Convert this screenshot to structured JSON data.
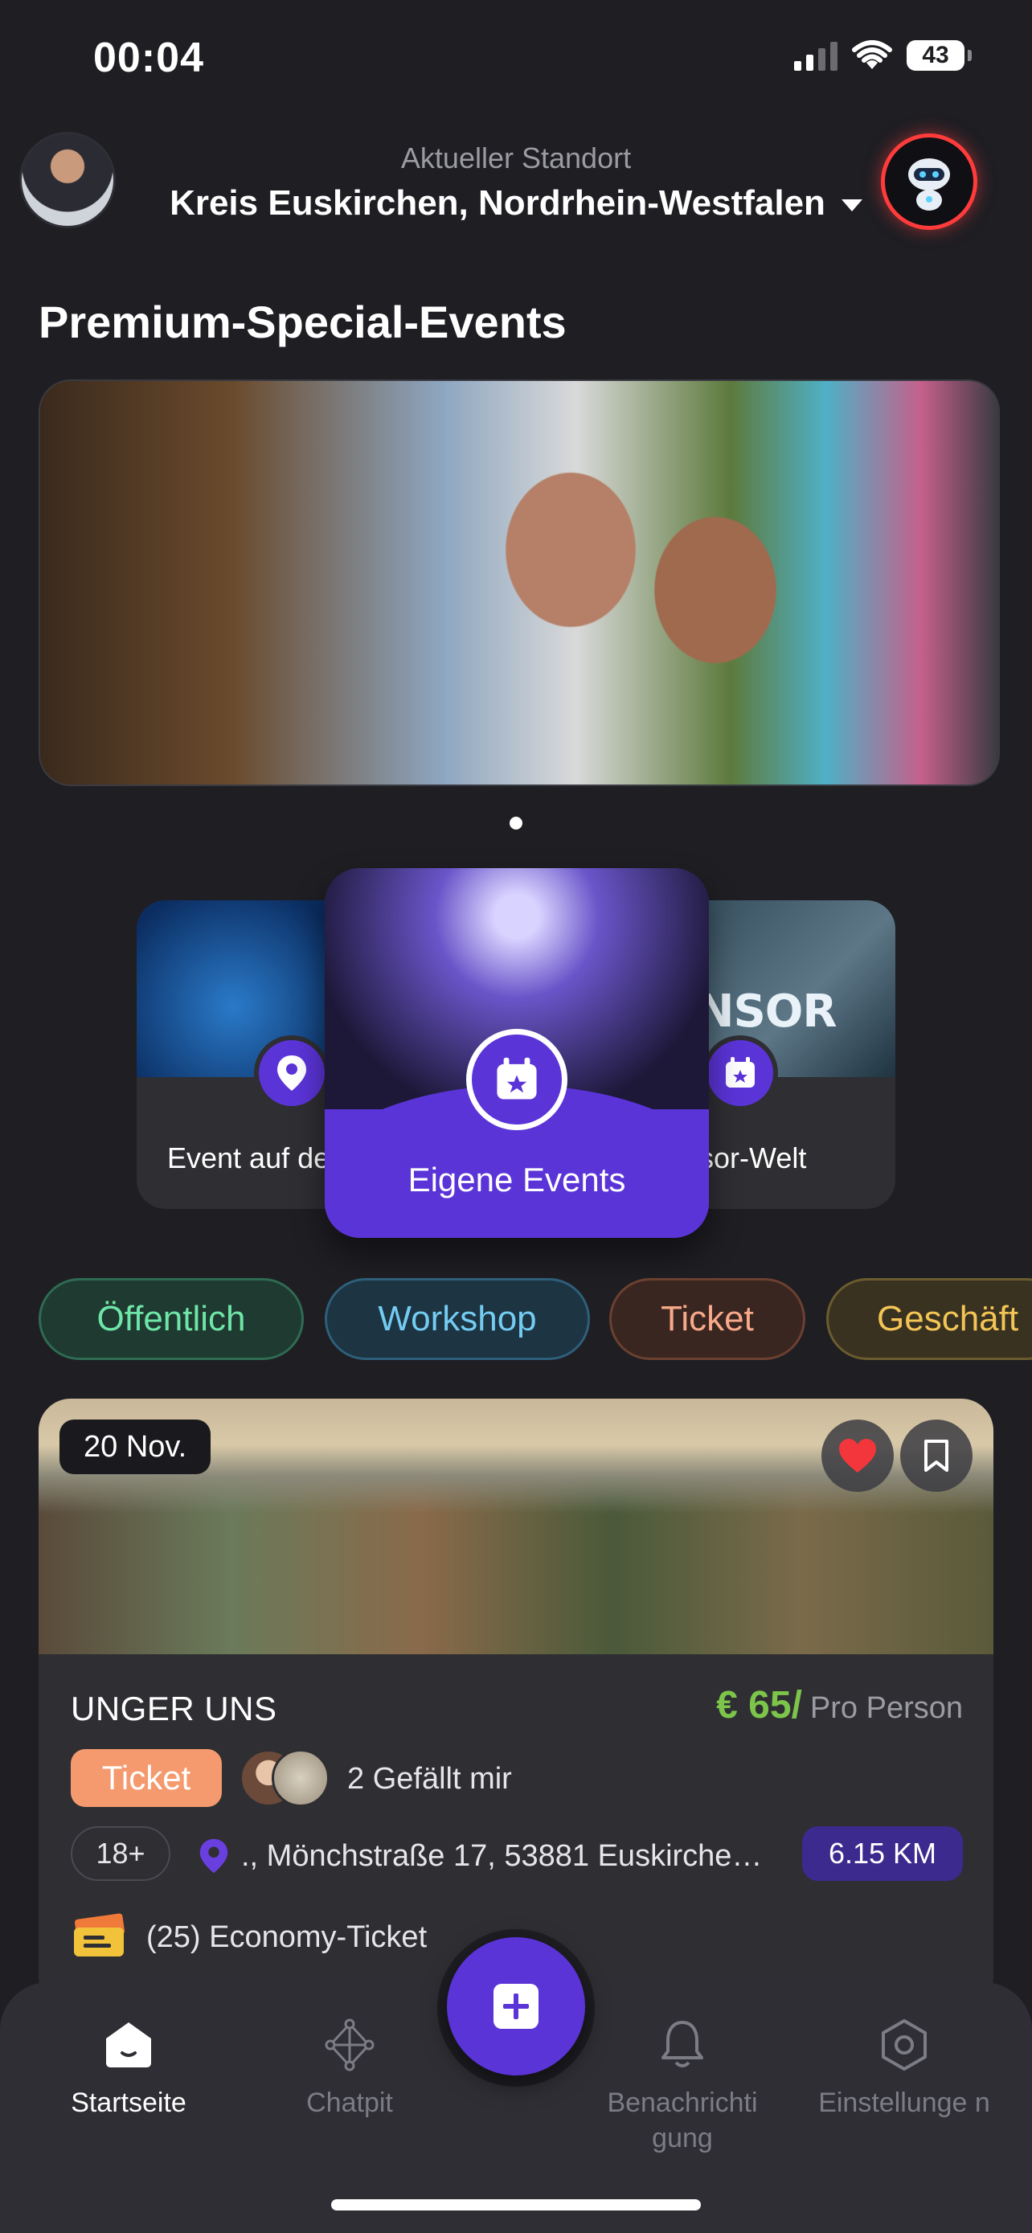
{
  "status_bar": {
    "time": "00:04",
    "battery": "43"
  },
  "header": {
    "location_label": "Aktueller Standort",
    "location_value": "Kreis Euskirchen, Nordrhein-Westfalen"
  },
  "section_title": "Premium-Special-Events",
  "carousel": {
    "left_label": "Event auf de",
    "center_label": "Eigene Events",
    "right_label": "sor-Welt",
    "right_image_text": "ONSOR"
  },
  "filters": [
    "Öffentlich",
    "Workshop",
    "Ticket",
    "Geschäft"
  ],
  "event": {
    "date": "20 Nov.",
    "title": "UNGER UNS",
    "price": "€ 65/",
    "price_unit": "Pro Person",
    "tag": "Ticket",
    "likes": "2 Gefällt mir",
    "age": "18+",
    "address": "., Mönchstraße 17, 53881 Euskirche…",
    "distance": "6.15 KM",
    "ticket_info": "(25) Economy-Ticket"
  },
  "nav": {
    "home": "Startseite",
    "chat": "Chatpit",
    "notifications": "Benachrichti gung",
    "settings": "Einstellunge n"
  },
  "colors": {
    "background": "#1e1e23",
    "accent_purple": "#5b34d8",
    "price_green": "#7dc44a",
    "ticket_orange": "#f59a6e"
  }
}
